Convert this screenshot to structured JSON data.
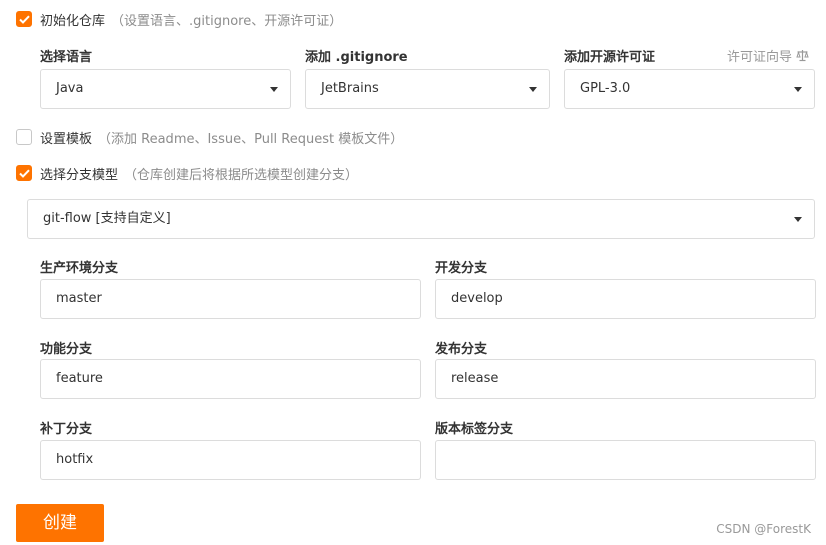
{
  "init_repo": {
    "checked": true,
    "label": "初始化仓库",
    "hint": "（设置语言、.gitignore、开源许可证）"
  },
  "language": {
    "label": "选择语言",
    "value": "Java"
  },
  "gitignore": {
    "label": "添加 .gitignore",
    "value": "JetBrains"
  },
  "license": {
    "label": "添加开源许可证",
    "value": "GPL-3.0",
    "guide_link": "许可证向导"
  },
  "template": {
    "checked": false,
    "label": "设置模板",
    "hint": "（添加 Readme、Issue、Pull Request 模板文件）"
  },
  "branch_model": {
    "checked": true,
    "label": "选择分支模型",
    "hint": "（仓库创建后将根据所选模型创建分支）",
    "value": "git-flow [支持自定义]"
  },
  "branches": {
    "production": {
      "label": "生产环境分支",
      "value": "master"
    },
    "develop": {
      "label": "开发分支",
      "value": "develop"
    },
    "feature": {
      "label": "功能分支",
      "value": "feature"
    },
    "release": {
      "label": "发布分支",
      "value": "release"
    },
    "hotfix": {
      "label": "补丁分支",
      "value": "hotfix"
    },
    "version_tag": {
      "label": "版本标签分支",
      "value": ""
    }
  },
  "create_button": "创建",
  "watermark": "CSDN @ForestK",
  "colors": {
    "accent": "#fe7300",
    "border": "#dcdcdc",
    "hint_text": "#8c8c8c"
  },
  "icons": [
    "checkmark-icon",
    "chevron-down-icon",
    "scale-icon"
  ]
}
